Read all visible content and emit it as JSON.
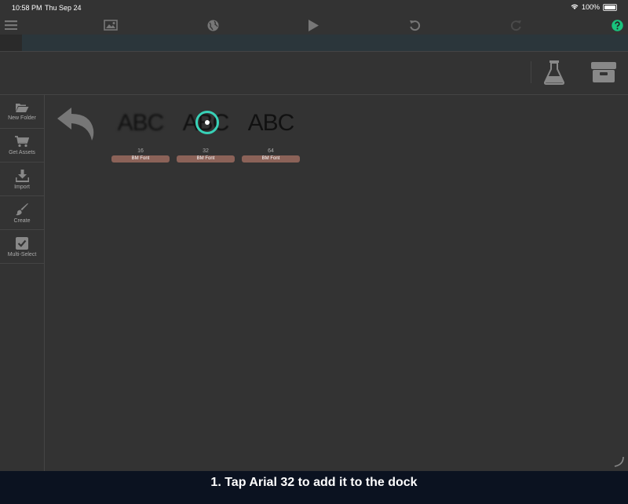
{
  "status": {
    "time": "10:58 PM",
    "date": "Thu Sep 24",
    "battery": "100%"
  },
  "sidebar": {
    "items": [
      {
        "label": "New Folder",
        "icon": "folder-open-icon"
      },
      {
        "label": "Get Assets",
        "icon": "cart-icon"
      },
      {
        "label": "Import",
        "icon": "download-icon"
      },
      {
        "label": "Create",
        "icon": "brush-icon"
      },
      {
        "label": "Multi-Select",
        "icon": "checkbox-icon"
      }
    ]
  },
  "assets": [
    {
      "preview": "ABC",
      "size": "16",
      "type": "BM Font"
    },
    {
      "preview": "ABC",
      "size": "32",
      "type": "BM Font"
    },
    {
      "preview": "ABC",
      "size": "64",
      "type": "BM Font"
    }
  ],
  "caption": "1. Tap Arial 32 to add it to the dock",
  "colors": {
    "accent": "#38d1b7",
    "badge": "#8b6258",
    "help": "#19c37d"
  }
}
